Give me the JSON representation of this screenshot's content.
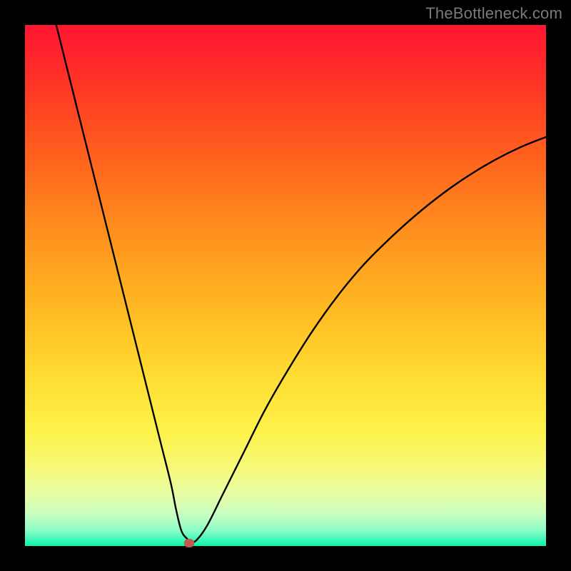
{
  "watermark": "TheBottleneck.com",
  "colors": {
    "frame": "#000000",
    "curve": "#000000",
    "marker": "#c15a4e",
    "gradient_top": "#ff1531",
    "gradient_bottom": "#0ef1a6"
  },
  "chart_data": {
    "type": "line",
    "title": "",
    "xlabel": "",
    "ylabel": "",
    "xlim": [
      0,
      100
    ],
    "ylim": [
      0,
      100
    ],
    "grid": false,
    "legend": false,
    "series": [
      {
        "name": "bottleneck-curve",
        "x": [
          6,
          8,
          10,
          12,
          14,
          16,
          18,
          20,
          22,
          24,
          26,
          28,
          29,
          30,
          31,
          32,
          33,
          35,
          38,
          42,
          46,
          50,
          55,
          60,
          65,
          70,
          75,
          80,
          85,
          90,
          95,
          100
        ],
        "y": [
          100,
          92,
          84,
          76,
          68,
          60,
          52,
          44,
          36,
          28,
          20,
          12,
          7,
          3,
          1.5,
          0.8,
          1.2,
          4,
          10,
          18,
          26,
          33,
          41,
          48,
          54,
          59,
          63.5,
          67.5,
          71,
          74,
          76.5,
          78.5
        ]
      }
    ],
    "marker": {
      "x": 31.5,
      "y": 0.5
    },
    "background": "vertical-gradient-red-to-green"
  }
}
